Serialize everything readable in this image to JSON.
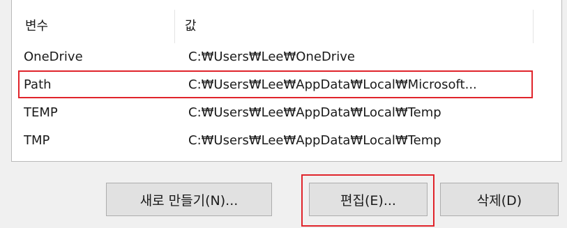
{
  "list": {
    "columns": {
      "variable": "변수",
      "value": "값"
    },
    "rows": [
      {
        "variable": "OneDrive",
        "value": "C:₩Users₩Lee₩OneDrive"
      },
      {
        "variable": "Path",
        "value": "C:₩Users₩Lee₩AppData₩Local₩Microsoft..."
      },
      {
        "variable": "TEMP",
        "value": "C:₩Users₩Lee₩AppData₩Local₩Temp"
      },
      {
        "variable": "TMP",
        "value": "C:₩Users₩Lee₩AppData₩Local₩Temp"
      }
    ],
    "selected_index": 1
  },
  "buttons": {
    "new_label": "새로 만들기(N)...",
    "edit_label": "편집(E)...",
    "delete_label": "삭제(D)"
  },
  "colors": {
    "highlight": "#e0242b",
    "button_bg": "#e1e1e1",
    "window_bg": "#f0f0f0"
  }
}
